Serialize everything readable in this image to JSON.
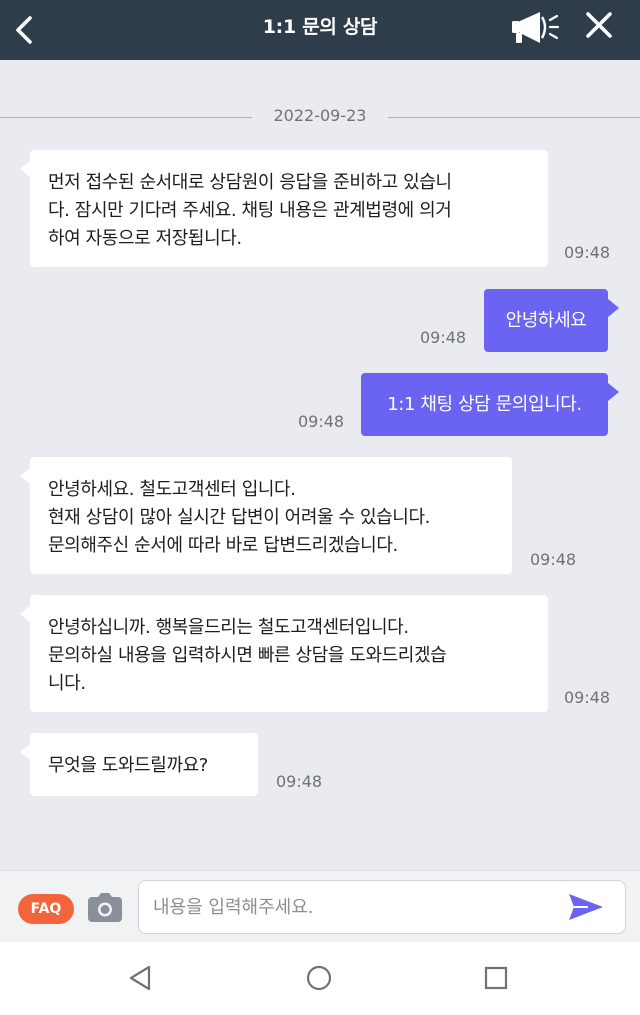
{
  "header": {
    "title": "1:1 문의 상담",
    "back_icon": "back-arrow-icon",
    "notice_icon": "megaphone-icon",
    "close_icon": "close-icon"
  },
  "date_divider": "2022-09-23",
  "messages": [
    {
      "side": "in",
      "lines": [
        "먼저 접수된 순서대로 상담원이 응답을 준비하고 있습니",
        "다. 잠시만 기다려 주세요. 채팅 내용은 관계법령에 의거",
        "하여 자동으로 저장됩니다."
      ],
      "time": "09:48"
    },
    {
      "side": "out",
      "lines": [
        "안녕하세요"
      ],
      "time": "09:48"
    },
    {
      "side": "out",
      "lines": [
        "1:1 채팅 상담 문의입니다."
      ],
      "time": "09:48"
    },
    {
      "side": "in",
      "lines": [
        "안녕하세요. 철도고객센터 입니다.",
        "현재 상담이 많아 실시간 답변이 어려울 수 있습니다.",
        "문의해주신 순서에 따라 바로 답변드리겠습니다."
      ],
      "time": "09:48"
    },
    {
      "side": "in",
      "lines": [
        "안녕하십니까. 행복을드리는 철도고객센터입니다.",
        "문의하실 내용을 입력하시면 빠른 상담을 도와드리겠습",
        "니다."
      ],
      "time": "09:48"
    },
    {
      "side": "in",
      "lines": [
        "무엇을 도와드릴까요?"
      ],
      "time": "09:48"
    }
  ],
  "input_bar": {
    "faq_label": "FAQ",
    "camera_icon": "camera-icon",
    "placeholder": "내용을 입력해주세요.",
    "value": "",
    "send_icon": "send-icon"
  },
  "navbar": {
    "back_icon": "nav-back-triangle-icon",
    "home_icon": "nav-home-circle-icon",
    "recents_icon": "nav-recents-square-icon"
  },
  "colors": {
    "header_bg": "#2f3d4b",
    "chat_bg": "#e9ebf0",
    "outgoing_bubble": "#6b63f2",
    "incoming_bubble": "#ffffff",
    "faq_badge": "#f4643c",
    "send_icon": "#6b63f2"
  }
}
